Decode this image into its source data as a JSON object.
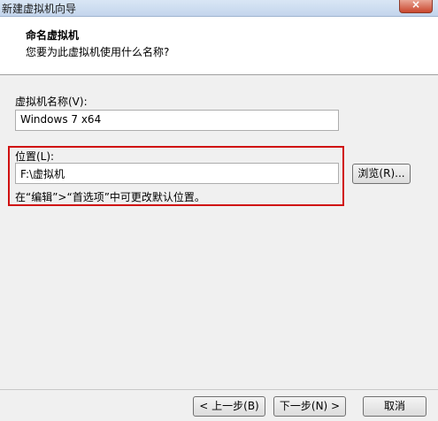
{
  "window": {
    "title": "新建虚拟机向导",
    "close_label": "×"
  },
  "header": {
    "title": "命名虚拟机",
    "subtitle": "您要为此虚拟机使用什么名称?"
  },
  "name_field": {
    "label": "虚拟机名称(V):",
    "value": "Windows 7 x64"
  },
  "location_field": {
    "label": "位置(L):",
    "value": "F:\\虚拟机",
    "browse_label": "浏览(R)..."
  },
  "hint": "在“编辑”>“首选项”中可更改默认位置。",
  "buttons": {
    "back": "< 上一步(B)",
    "next": "下一步(N) >",
    "cancel": "取消"
  },
  "colors": {
    "highlight": "#d01010"
  }
}
